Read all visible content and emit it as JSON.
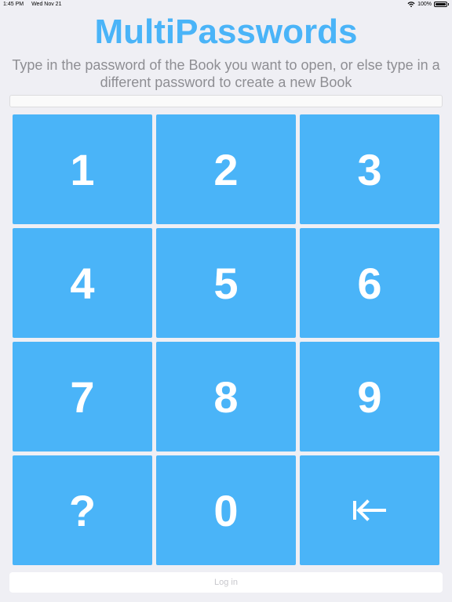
{
  "status_bar": {
    "time": "1:45 PM",
    "date": "Wed Nov 21",
    "battery": "100%",
    "wifi_icon": "wifi-icon",
    "battery_icon": "battery-icon"
  },
  "header": {
    "title": "MultiPasswords",
    "instructions": "Type in the password of the Book you want to open, or else type in a different password to create a new Book"
  },
  "password_input": {
    "value": "",
    "placeholder": ""
  },
  "keypad": {
    "keys": [
      "1",
      "2",
      "3",
      "4",
      "5",
      "6",
      "7",
      "8",
      "9",
      "?",
      "0"
    ],
    "backspace_icon": "backspace-arrow-icon"
  },
  "login": {
    "label": "Log in"
  },
  "colors": {
    "accent": "#4ab4f8",
    "background": "#efeff4",
    "instruction_text": "#8e8e93",
    "disabled_text": "#c7c7cc",
    "key_text": "#ffffff"
  }
}
